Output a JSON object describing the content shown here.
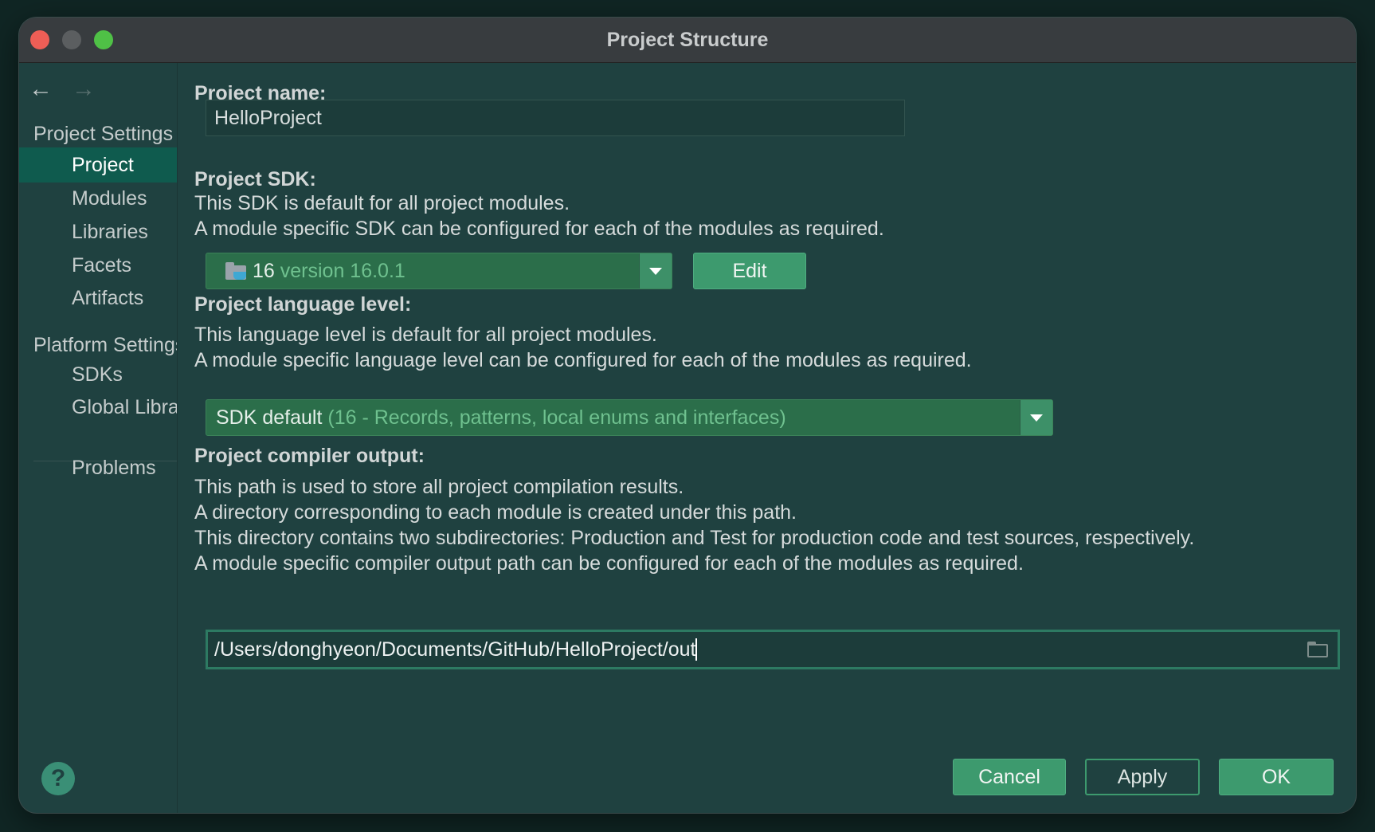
{
  "window": {
    "title": "Project Structure"
  },
  "sidebar": {
    "back_icon": "←",
    "forward_icon": "→",
    "project_settings_header": "Project Settings",
    "project_items": [
      "Project",
      "Modules",
      "Libraries",
      "Facets",
      "Artifacts"
    ],
    "selected_item": "Project",
    "platform_settings_header": "Platform Settings",
    "platform_items": [
      "SDKs",
      "Global Libraries"
    ],
    "problems_label": "Problems"
  },
  "project_name": {
    "label": "Project name:",
    "value": "HelloProject"
  },
  "project_sdk": {
    "label": "Project SDK:",
    "desc_line1": "This SDK is default for all project modules.",
    "desc_line2": "A module specific SDK can be configured for each of the modules as required.",
    "selected_name": "16",
    "selected_detail": "version 16.0.1",
    "edit_label": "Edit"
  },
  "language_level": {
    "label": "Project language level:",
    "desc_line1": "This language level is default for all project modules.",
    "desc_line2": "A module specific language level can be configured for each of the modules as required.",
    "selected_name": "SDK default",
    "selected_detail": "(16 - Records, patterns, local enums and interfaces)"
  },
  "compiler_output": {
    "label": "Project compiler output:",
    "desc_line1": "This path is used to store all project compilation results.",
    "desc_line2": "A directory corresponding to each module is created under this path.",
    "desc_line3": "This directory contains two subdirectories: Production and Test for production code and test sources, respectively.",
    "desc_line4": "A module specific compiler output path can be configured for each of the modules as required.",
    "path": "/Users/donghyeon/Documents/GitHub/HelloProject/out"
  },
  "footer": {
    "help_label": "?",
    "cancel_label": "Cancel",
    "apply_label": "Apply",
    "ok_label": "OK"
  },
  "colors": {
    "accent": "#3d9a6e",
    "selection": "#0f5b4e",
    "background": "#1f4140"
  }
}
